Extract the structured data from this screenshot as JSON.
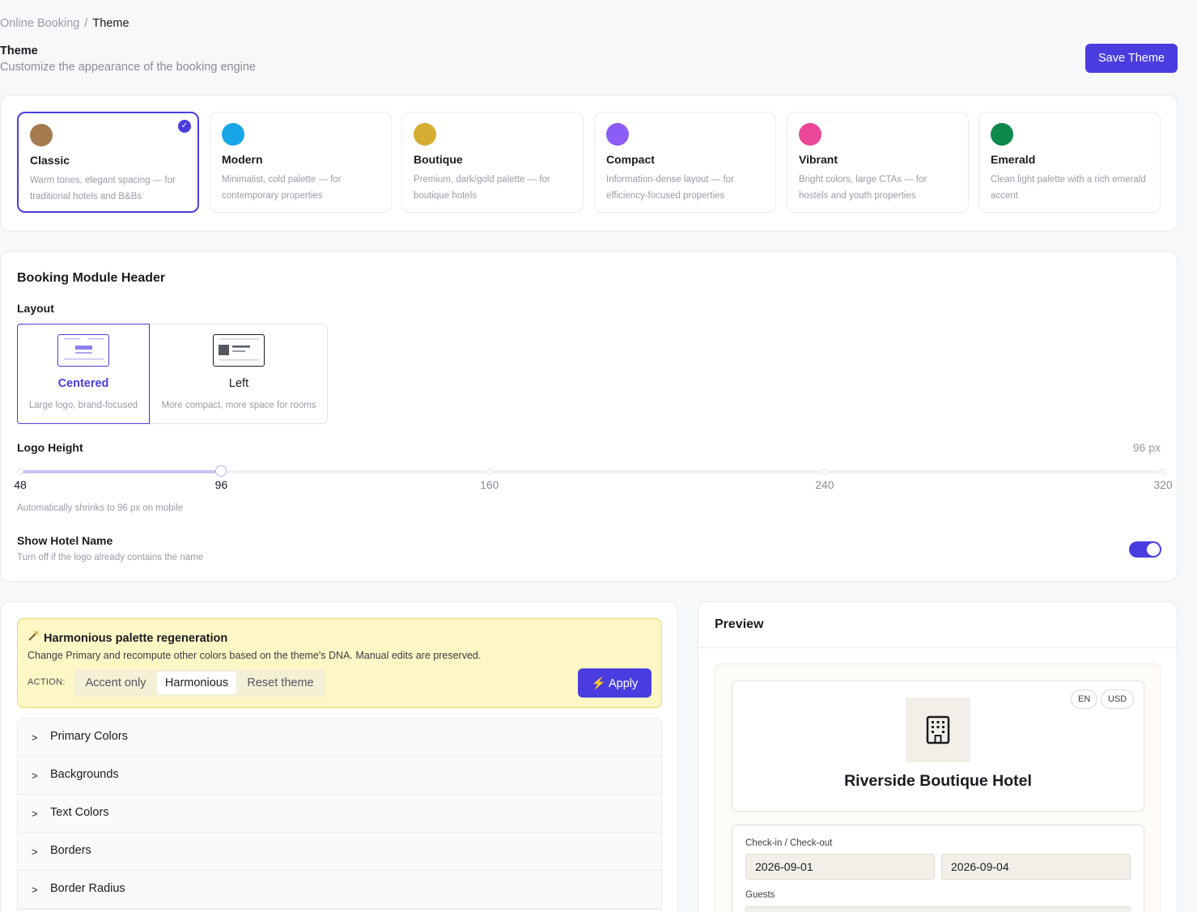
{
  "breadcrumb": {
    "parent": "Online Booking",
    "separator": "/",
    "current": "Theme"
  },
  "header": {
    "title": "Theme",
    "subtitle": "Customize the appearance of the booking engine",
    "save_label": "Save Theme"
  },
  "themes": [
    {
      "name": "Classic",
      "desc": "Warm tones, elegant spacing — for traditional hotels and B&Bs",
      "color": "#a47a4f",
      "selected": true
    },
    {
      "name": "Modern",
      "desc": "Minimalist, cold palette — for contemporary properties",
      "color": "#17a6e8"
    },
    {
      "name": "Boutique",
      "desc": "Premium, dark/gold palette — for boutique hotels",
      "color": "#d6ad33"
    },
    {
      "name": "Compact",
      "desc": "Information-dense layout — for efficiency-focused properties",
      "color": "#8b5cf6"
    },
    {
      "name": "Vibrant",
      "desc": "Bright colors, large CTAs — for hostels and youth properties",
      "color": "#ec4899"
    },
    {
      "name": "Emerald",
      "desc": "Clean light palette with a rich emerald accent",
      "color": "#0d8a4b"
    }
  ],
  "module_header": {
    "title": "Booking Module Header",
    "layout_label": "Layout",
    "layouts": [
      {
        "name": "Centered",
        "desc": "Large logo, brand-focused",
        "active": true
      },
      {
        "name": "Left",
        "desc": "More compact, more space for rooms",
        "active": false
      }
    ],
    "logo_height": {
      "label": "Logo Height",
      "value_text": "96 px",
      "min": 48,
      "max": 320,
      "value": 96,
      "ticks": [
        "48",
        "96",
        "160",
        "240",
        "320"
      ],
      "note": "Automatically shrinks to 96 px on mobile"
    },
    "show_hotel_name": {
      "label": "Show Hotel Name",
      "desc": "Turn off if the logo already contains the name",
      "enabled": true
    }
  },
  "harmony": {
    "icon": "magic-wand-icon",
    "title": "Harmonious palette regeneration",
    "desc": "Change Primary and recompute other colors based on the theme's DNA. Manual edits are preserved.",
    "action_label": "ACTION:",
    "actions": [
      "Accent only",
      "Harmonious",
      "Reset theme"
    ],
    "active_action": "Harmonious",
    "apply_label": "Apply",
    "apply_icon": "lightning-icon"
  },
  "color_sections": [
    "Primary Colors",
    "Backgrounds",
    "Text Colors",
    "Borders",
    "Border Radius"
  ],
  "preview": {
    "title": "Preview",
    "lang": "EN",
    "currency": "USD",
    "hotel_name": "Riverside Boutique Hotel",
    "dates_label": "Check-in / Check-out",
    "checkin": "2026-09-01",
    "checkout": "2026-09-04",
    "guests_label": "Guests"
  },
  "colors": {
    "accent": "#4a3de0",
    "warning_bg": "#fdf7c5"
  }
}
